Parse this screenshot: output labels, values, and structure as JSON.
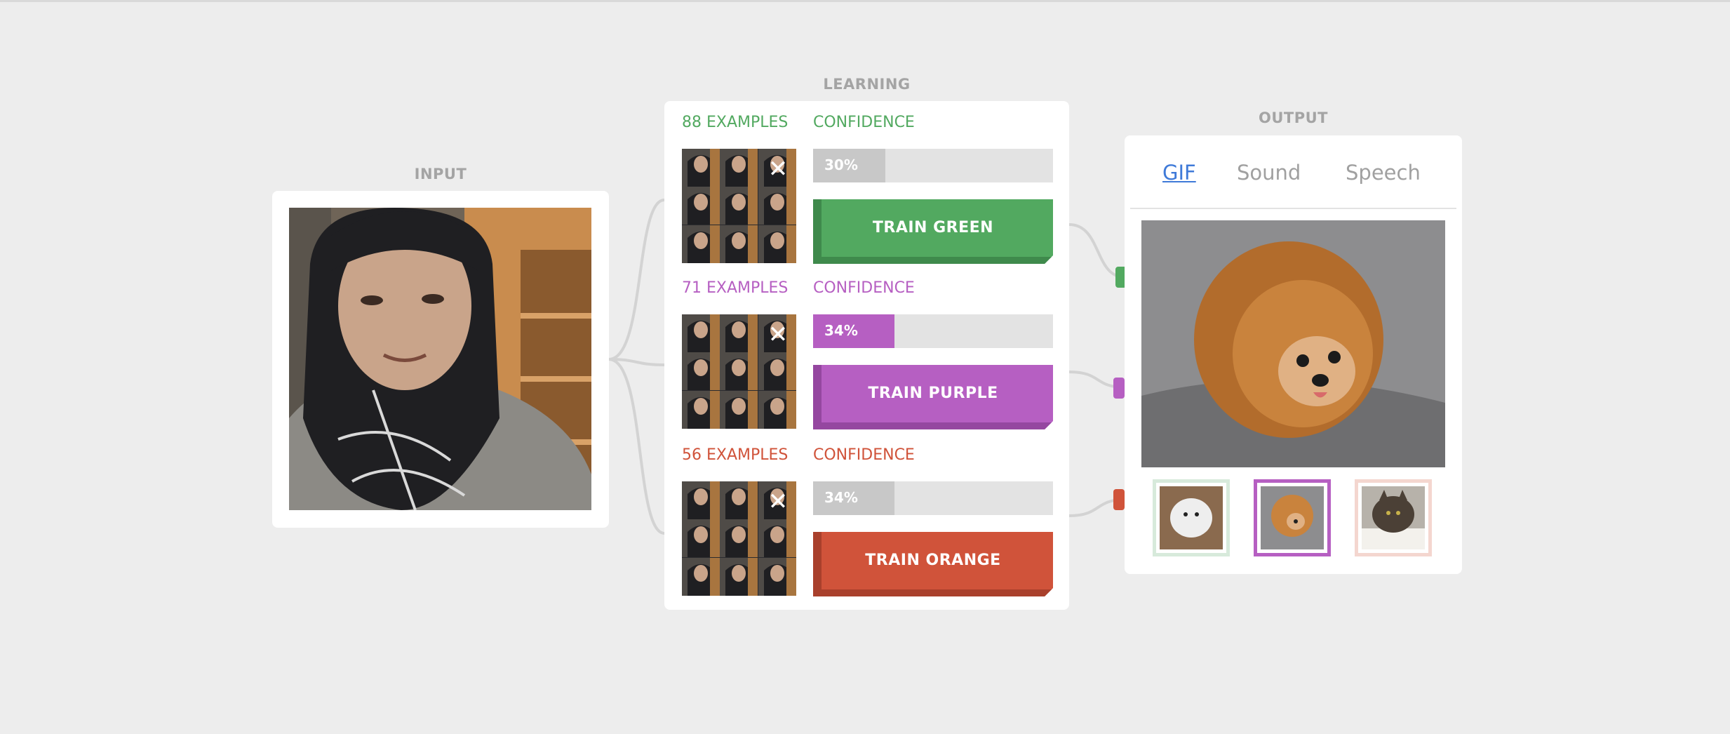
{
  "sections": {
    "input": "INPUT",
    "learning": "LEARNING",
    "output": "OUTPUT"
  },
  "classes": [
    {
      "id": "green",
      "examples": "88 EXAMPLES",
      "confidence_label": "CONFIDENCE",
      "confidence": 30,
      "confidence_text": "30%",
      "button": "TRAIN GREEN",
      "color": "#52a960",
      "fill": "#c8c8c8",
      "shade": "#3f8a4c"
    },
    {
      "id": "purple",
      "examples": "71 EXAMPLES",
      "confidence_label": "CONFIDENCE",
      "confidence": 34,
      "confidence_text": "34%",
      "button": "TRAIN PURPLE",
      "color": "#b65fc2",
      "fill": "#b65fc2",
      "shade": "#9547a0"
    },
    {
      "id": "orange",
      "examples": "56 EXAMPLES",
      "confidence_label": "CONFIDENCE",
      "confidence": 34,
      "confidence_text": "34%",
      "button": "TRAIN ORANGE",
      "color": "#d0533a",
      "fill": "#c8c8c8",
      "shade": "#a9402c"
    }
  ],
  "output": {
    "tabs": [
      "GIF",
      "Sound",
      "Speech"
    ],
    "active_tab": "GIF",
    "gif_choices": [
      {
        "subject": "white-puppy",
        "border": "#d7eadb"
      },
      {
        "subject": "pomeranian",
        "border": "#b65fc2"
      },
      {
        "subject": "cat",
        "border": "#f4d6cf"
      }
    ]
  },
  "colors": {
    "background": "#ededed",
    "panel": "#ffffff",
    "section_title": "#a4a4a4",
    "tab_active": "#3f7ad8",
    "tab_inactive": "#a0a0a0"
  },
  "icons": {
    "clear": "close-icon"
  }
}
